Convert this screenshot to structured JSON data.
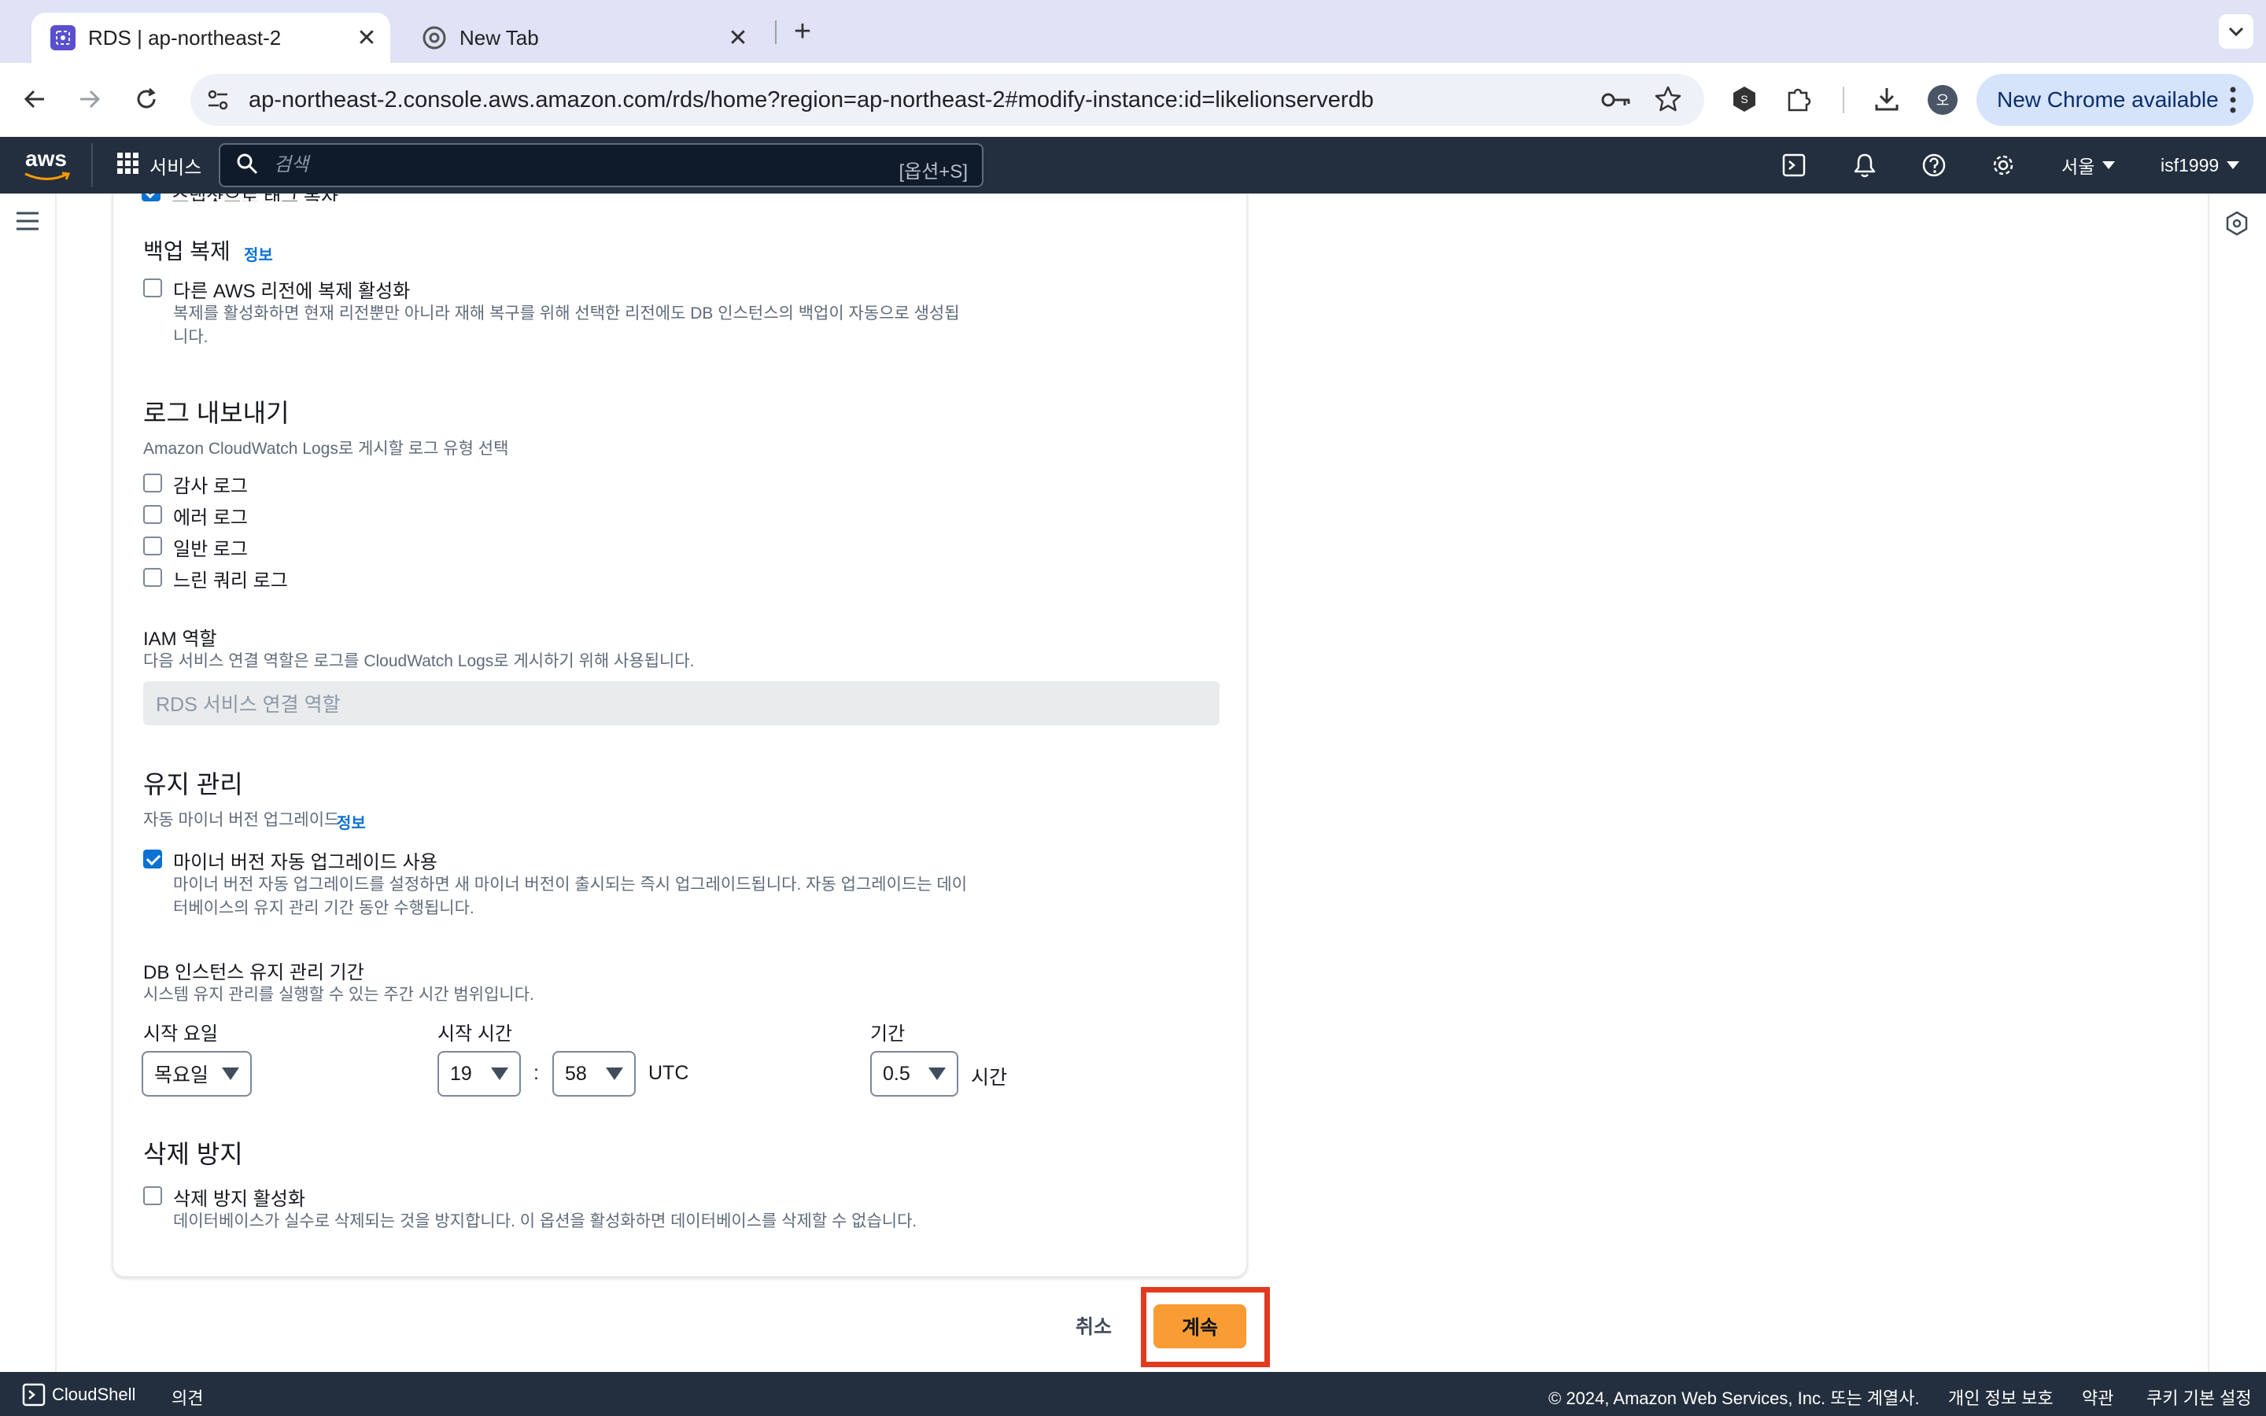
{
  "browser": {
    "tabs": [
      {
        "title": "RDS | ap-northeast-2",
        "active": true
      },
      {
        "title": "New Tab",
        "active": false
      }
    ],
    "new_tab_symbol": "+",
    "url": "ap-northeast-2.console.aws.amazon.com/rds/home?region=ap-northeast-2#modify-instance:id=likelionserverdb",
    "new_chrome_label": "New Chrome available",
    "profile_initial": "오"
  },
  "aws_header": {
    "logo": "aws",
    "services_label": "서비스",
    "search_placeholder": "검색",
    "search_shortcut": "[옵션+S]",
    "region": "서울",
    "account": "isf1999"
  },
  "form": {
    "top_partial_checkbox": {
      "label": "스냅샷으로 태그 복사",
      "checked": true
    },
    "backup_replication": {
      "title": "백업 복제",
      "info": "정보",
      "checkbox": {
        "label": "다른 AWS 리전에 복제 활성화",
        "checked": false,
        "desc_line1": "복제를 활성화하면 현재 리전뿐만 아니라 재해 복구를 위해 선택한 리전에도 DB 인스턴스의 백업이 자동으로 생성됩",
        "desc_line2": "니다."
      }
    },
    "log_export": {
      "title": "로그 내보내기",
      "desc": "Amazon CloudWatch Logs로 게시할 로그 유형 선택",
      "options": [
        {
          "label": "감사 로그",
          "checked": false
        },
        {
          "label": "에러 로그",
          "checked": false
        },
        {
          "label": "일반 로그",
          "checked": false
        },
        {
          "label": "느린 쿼리 로그",
          "checked": false
        }
      ]
    },
    "iam_role": {
      "title": "IAM 역할",
      "desc": "다음 서비스 연결 역할은 로그를 CloudWatch Logs로 게시하기 위해 사용됩니다.",
      "value": "RDS 서비스 연결 역할"
    },
    "maintenance": {
      "title": "유지 관리",
      "auto_minor_label": "자동 마이너 버전 업그레이드",
      "info": "정보",
      "checkbox": {
        "label": "마이너 버전 자동 업그레이드 사용",
        "checked": true,
        "desc_line1": "마이너 버전 자동 업그레이드를 설정하면 새 마이너 버전이 출시되는 즉시 업그레이드됩니다. 자동 업그레이드는 데이",
        "desc_line2": "터베이스의 유지 관리 기간 동안 수행됩니다."
      },
      "window": {
        "title": "DB 인스턴스 유지 관리 기간",
        "desc": "시스템 유지 관리를 실행할 수 있는 주간 시간 범위입니다.",
        "start_day_label": "시작 요일",
        "start_day_value": "목요일",
        "start_time_label": "시작 시간",
        "hour_value": "19",
        "separator": ":",
        "minute_value": "58",
        "timezone": "UTC",
        "duration_label": "기간",
        "duration_value": "0.5",
        "duration_unit": "시간"
      }
    },
    "deletion_protection": {
      "title": "삭제 방지",
      "checkbox": {
        "label": "삭제 방지 활성화",
        "checked": false,
        "desc": "데이터베이스가 실수로 삭제되는 것을 방지합니다. 이 옵션을 활성화하면 데이터베이스를 삭제할 수 없습니다."
      }
    }
  },
  "actions": {
    "cancel_label": "취소",
    "continue_label": "계속",
    "highlight_color": "#e23a1f",
    "primary_color": "#f89c33"
  },
  "footer": {
    "cloudshell": "CloudShell",
    "feedback": "의견",
    "copyright": "© 2024, Amazon Web Services, Inc. 또는 계열사.",
    "privacy": "개인 정보 보호",
    "terms": "약관",
    "cookies": "쿠키 기본 설정"
  }
}
